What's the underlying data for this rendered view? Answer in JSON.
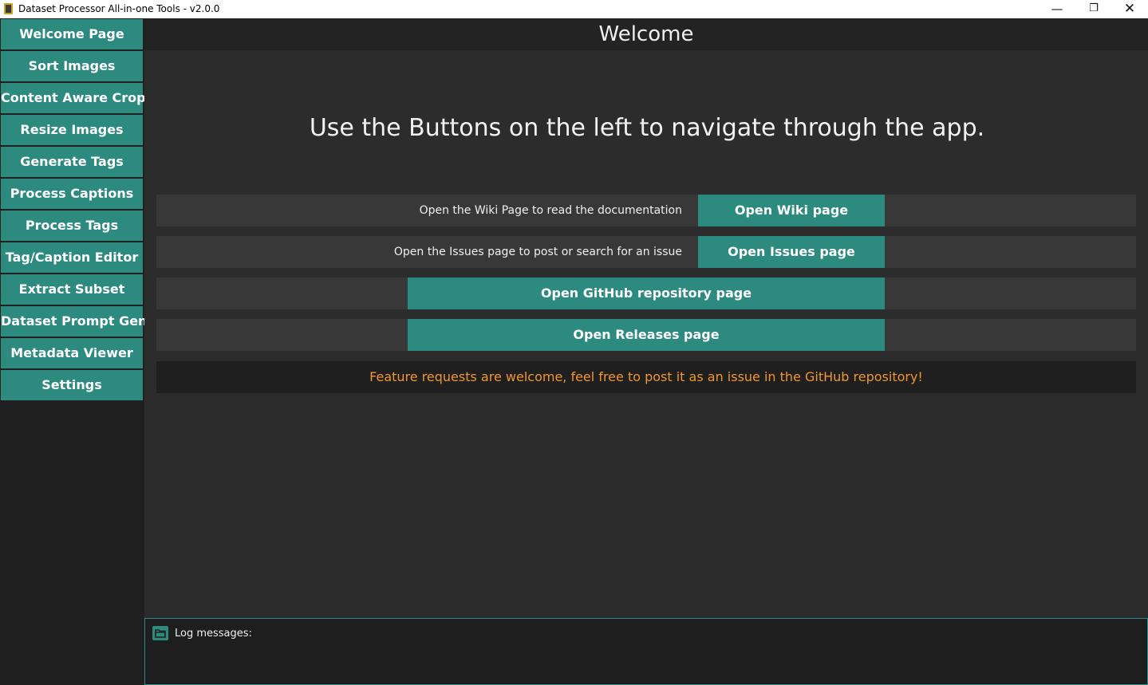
{
  "window": {
    "title": "Dataset Processor All-in-one Tools - v2.0.0",
    "controls": {
      "minimize": "—",
      "maximize": "❐",
      "close": "✕"
    }
  },
  "sidebar": {
    "items": [
      {
        "label": "Welcome Page"
      },
      {
        "label": "Sort Images"
      },
      {
        "label": "Content Aware Crop"
      },
      {
        "label": "Resize Images"
      },
      {
        "label": "Generate Tags"
      },
      {
        "label": "Process Captions"
      },
      {
        "label": "Process Tags"
      },
      {
        "label": "Tag/Caption Editor"
      },
      {
        "label": "Extract Subset"
      },
      {
        "label": "Dataset Prompt Gen"
      },
      {
        "label": "Metadata Viewer"
      },
      {
        "label": "Settings"
      }
    ]
  },
  "header": {
    "title": "Welcome"
  },
  "main": {
    "headline": "Use the Buttons on the left to navigate through the app.",
    "wiki": {
      "text": "Open the Wiki Page to read the documentation",
      "button": "Open Wiki page"
    },
    "issues": {
      "text": "Open the Issues page to post or search for an issue",
      "button": "Open Issues page"
    },
    "github_button": "Open GitHub repository page",
    "releases_button": "Open Releases page",
    "feature_note": "Feature requests are welcome, feel free to post it as an issue in the GitHub repository!"
  },
  "log": {
    "label": "Log messages:"
  },
  "colors": {
    "accent": "#2d8a7e",
    "background": "#2c2c2c",
    "sidebar": "#202020",
    "row": "#383838",
    "feature_text": "#f0962e"
  }
}
